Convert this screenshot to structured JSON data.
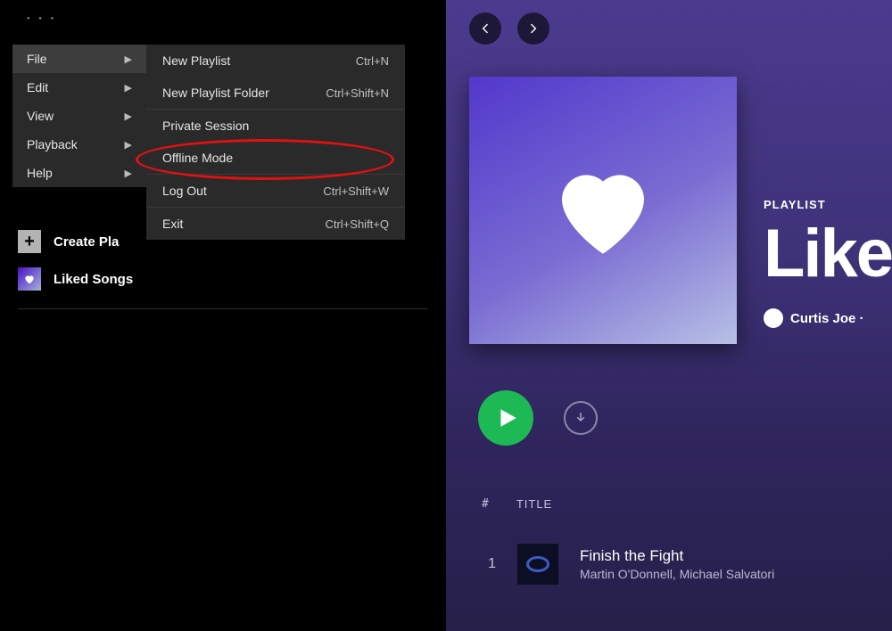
{
  "menu": {
    "root": [
      {
        "label": "File",
        "selected": true
      },
      {
        "label": "Edit"
      },
      {
        "label": "View"
      },
      {
        "label": "Playback"
      },
      {
        "label": "Help"
      }
    ],
    "submenu": [
      {
        "label": "New Playlist",
        "shortcut": "Ctrl+N"
      },
      {
        "label": "New Playlist Folder",
        "shortcut": "Ctrl+Shift+N"
      },
      {
        "divider": true
      },
      {
        "label": "Private Session",
        "shortcut": ""
      },
      {
        "label": "Offline Mode",
        "shortcut": "",
        "highlighted": true
      },
      {
        "divider": true
      },
      {
        "label": "Log Out",
        "shortcut": "Ctrl+Shift+W"
      },
      {
        "divider": true
      },
      {
        "label": "Exit",
        "shortcut": "Ctrl+Shift+Q"
      }
    ]
  },
  "sidebar": {
    "create": "Create Pla",
    "liked": "Liked Songs"
  },
  "playlist": {
    "type_label": "PLAYLIST",
    "title": "Like",
    "owner": "Curtis Joe",
    "owner_suffix": " · ",
    "columns": {
      "num": "#",
      "title": "TITLE"
    },
    "tracks": [
      {
        "num": "1",
        "title": "Finish the Fight",
        "artist": "Martin O'Donnell, Michael Salvatori"
      }
    ]
  }
}
